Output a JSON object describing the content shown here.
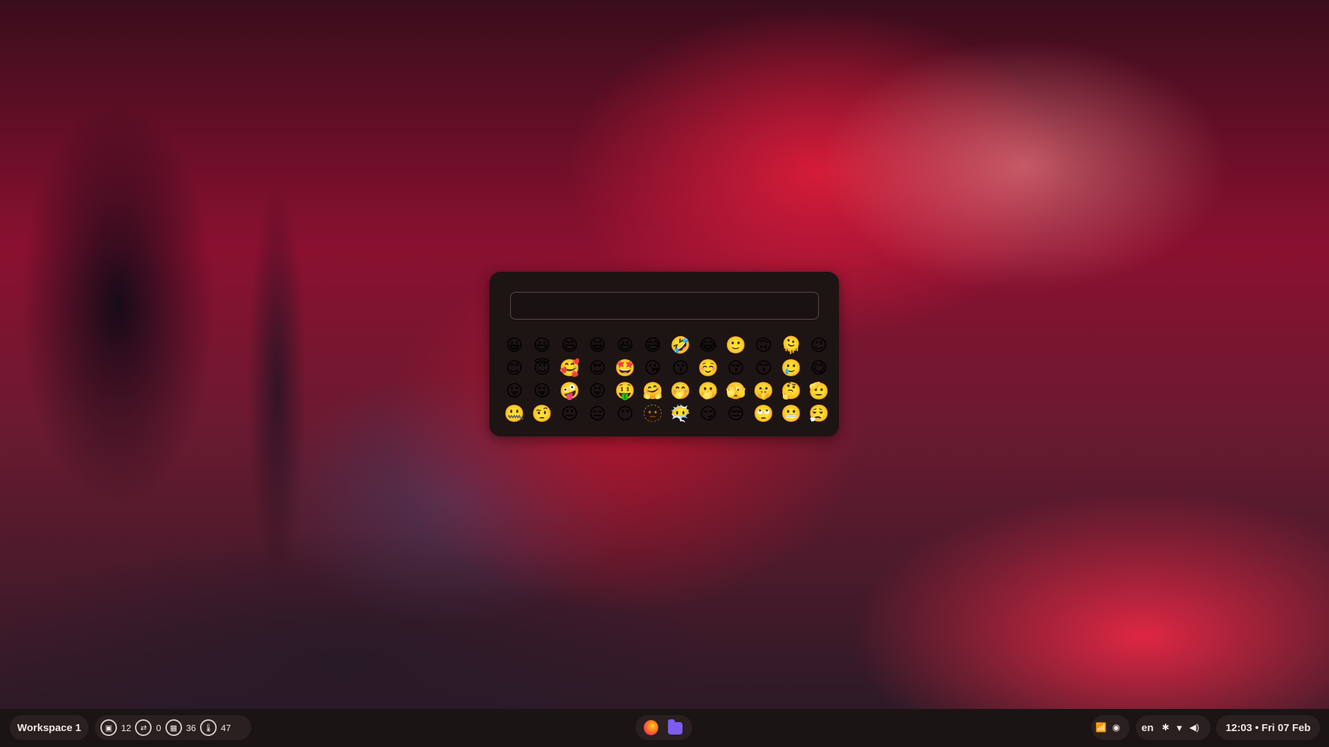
{
  "emoji_picker": {
    "search_value": "",
    "emojis": [
      "😀",
      "😃",
      "😄",
      "😁",
      "😆",
      "😅",
      "🤣",
      "😂",
      "🙂",
      "🙃",
      "🫠",
      "😉",
      "😊",
      "😇",
      "🥰",
      "😍",
      "🤩",
      "😘",
      "😗",
      "☺️",
      "😚",
      "😙",
      "🥲",
      "😋",
      "😛",
      "😜",
      "🤪",
      "😝",
      "🤑",
      "🤗",
      "🤭",
      "🫢",
      "🫣",
      "🤫",
      "🤔",
      "🫡",
      "🤐",
      "🤨",
      "😐",
      "😑",
      "😶",
      "🫥",
      "😶‍🌫️",
      "😏",
      "😒",
      "🙄",
      "😬",
      "😮‍💨"
    ]
  },
  "taskbar": {
    "workspace": "Workspace 1",
    "resources": [
      {
        "icon": "cpu-icon",
        "value": "12"
      },
      {
        "icon": "swap-icon",
        "value": "0"
      },
      {
        "icon": "memory-icon",
        "value": "36"
      },
      {
        "icon": "temperature-icon",
        "value": "47"
      }
    ],
    "apps": [
      "firefox-icon",
      "files-icon"
    ],
    "tray": [
      "signal-icon",
      "tray-app-icon"
    ],
    "language": "en",
    "system_icons": [
      "bluetooth-off-icon",
      "wifi-icon",
      "volume-icon"
    ],
    "clock": "12:03 • Fri 07 Feb"
  }
}
